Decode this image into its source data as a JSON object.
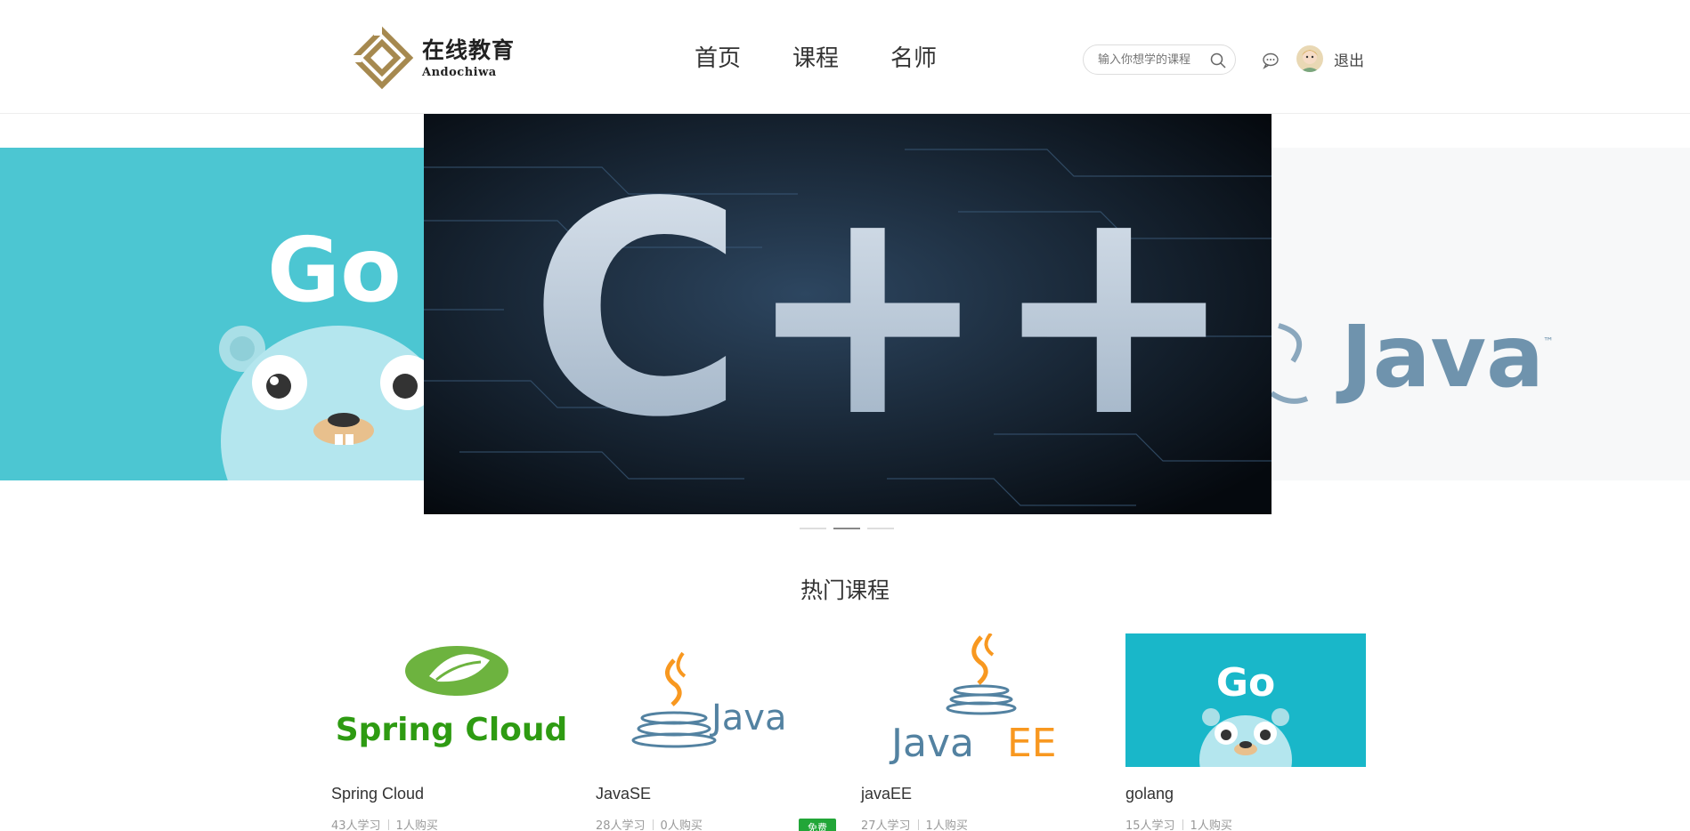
{
  "brand": {
    "name_cn": "在线教育",
    "name_en": "Andochiwa",
    "logo_color": "#a6894f"
  },
  "nav": {
    "items": [
      "首页",
      "课程",
      "名师"
    ]
  },
  "search": {
    "placeholder": "输入你想学的课程"
  },
  "user": {
    "logout_label": "退出"
  },
  "banner": {
    "slides": [
      {
        "name": "golang-banner",
        "text": "Go"
      },
      {
        "name": "cpp-banner",
        "text": "C++"
      },
      {
        "name": "java-banner",
        "text": "Java"
      }
    ],
    "active_index": 1
  },
  "hot_courses": {
    "title": "热门课程",
    "courses": [
      {
        "title": "Spring Cloud",
        "image_text": "Spring Cloud",
        "learners": "43人学习",
        "buyers": "1人购买",
        "badge": ""
      },
      {
        "title": "JavaSE",
        "image_text": "Java",
        "learners": "28人学习",
        "buyers": "0人购买",
        "badge": "免费"
      },
      {
        "title": "javaEE",
        "image_text": "Java EE",
        "learners": "27人学习",
        "buyers": "1人购买",
        "badge": ""
      },
      {
        "title": "golang",
        "image_text": "Go",
        "learners": "15人学习",
        "buyers": "1人购买",
        "badge": ""
      }
    ]
  },
  "colors": {
    "accent_green": "#22a638",
    "go_teal": "#4cc6d2",
    "java_blue": "#5382a1",
    "java_orange": "#f89820",
    "spring_green": "#6db33f"
  }
}
